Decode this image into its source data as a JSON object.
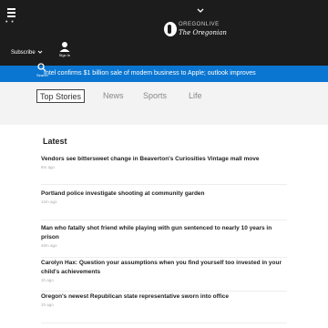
{
  "header": {
    "subscribe_label": "Subscribe",
    "signin_label": "Sign In",
    "logo_top": "OREGONLIVE",
    "logo_bottom": "The Oregonian",
    "search_label": "Search"
  },
  "ticker": {
    "text": "Intel confirms $1 billion sale of modem business to Apple; outlook improves"
  },
  "tabs": [
    {
      "label": "Top Stories"
    },
    {
      "label": "News"
    },
    {
      "label": "Sports"
    },
    {
      "label": "Life"
    }
  ],
  "latest_heading": "Latest",
  "stories": [
    {
      "title": "Vendors see bittersweet change in Beaverton's Curiosities Vintage mall move",
      "time": "6m ago"
    },
    {
      "title": "Portland police investigate shooting at community garden",
      "time": "12m ago"
    },
    {
      "title": "Man who fatally shot friend while playing with gun sentenced to nearly 10 years in prison",
      "time": "40m ago"
    },
    {
      "title": "Carolyn Hax: Question your assumptions when you find yourself too invested in your child's achievements",
      "time": "1h ago"
    },
    {
      "title": "Oregon's newest Republican state representative sworn into office",
      "time": "1h ago"
    }
  ]
}
